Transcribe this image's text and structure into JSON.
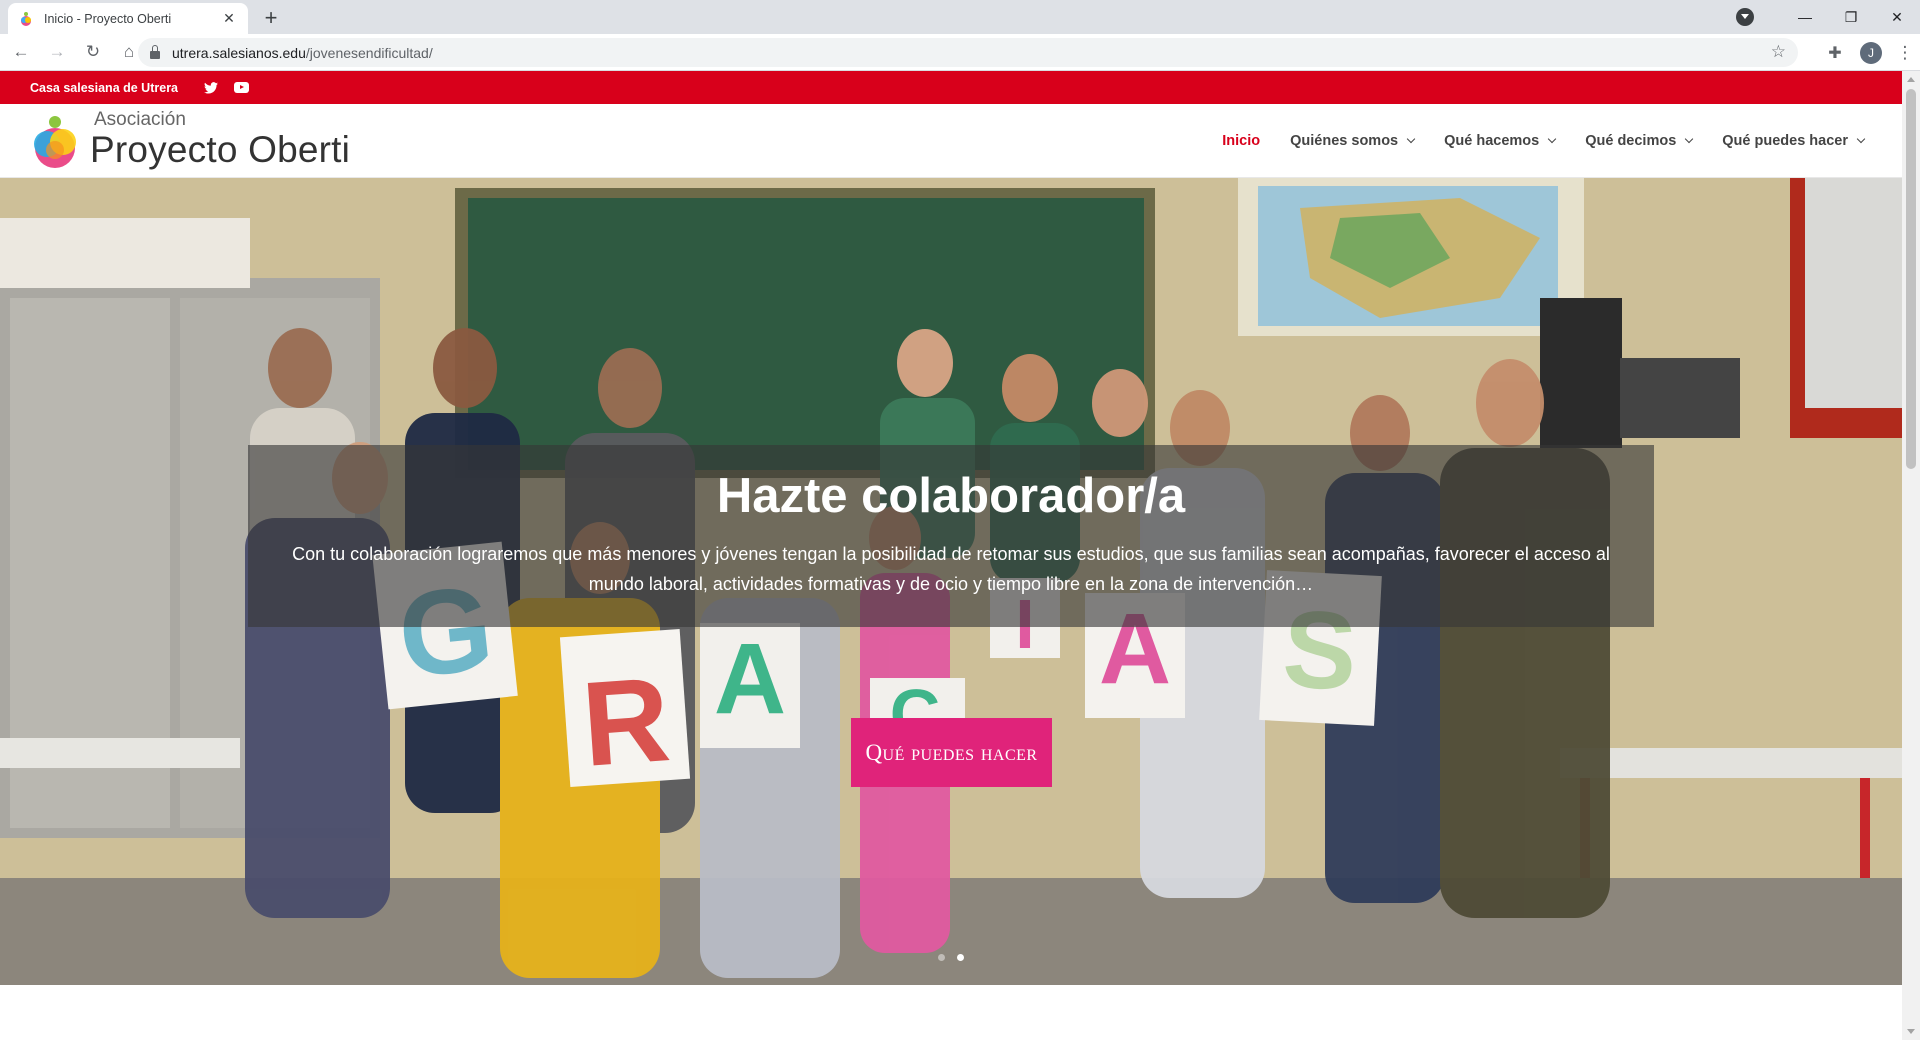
{
  "browser": {
    "tab_title": "Inicio - Proyecto Oberti",
    "url_host": "utrera.salesianos.edu",
    "url_path": "/jovenesendificultad/",
    "profile_initial": "J"
  },
  "topbar": {
    "site_name": "Casa salesiana de Utrera",
    "social": [
      "twitter-icon",
      "youtube-icon"
    ]
  },
  "header": {
    "logo_small": "Asociación",
    "logo_big": "Proyecto Oberti",
    "nav": [
      {
        "label": "Inicio",
        "active": true
      },
      {
        "label": "Quiénes somos",
        "dropdown": true
      },
      {
        "label": "Qué hacemos",
        "dropdown": true
      },
      {
        "label": "Qué decimos",
        "dropdown": true
      },
      {
        "label": "Qué puedes hacer",
        "dropdown": true
      }
    ]
  },
  "hero": {
    "title": "Hazte colaborador/a",
    "text": "Con tu colaboración lograremos que más menores y jóvenes tengan la posibilidad de retomar sus estudios, que sus familias sean acompañas, favorecer el acceso al mundo laboral, actividades formativas y de ocio y tiempo libre en la zona de intervención…",
    "button": "Qué puedes hacer",
    "slides": 2,
    "active_slide": 2,
    "photo_letters": [
      "G",
      "R",
      "A",
      "C",
      "I",
      "A",
      "S"
    ]
  },
  "colors": {
    "brand_red": "#d8001b",
    "button_pink": "#e0237a"
  }
}
